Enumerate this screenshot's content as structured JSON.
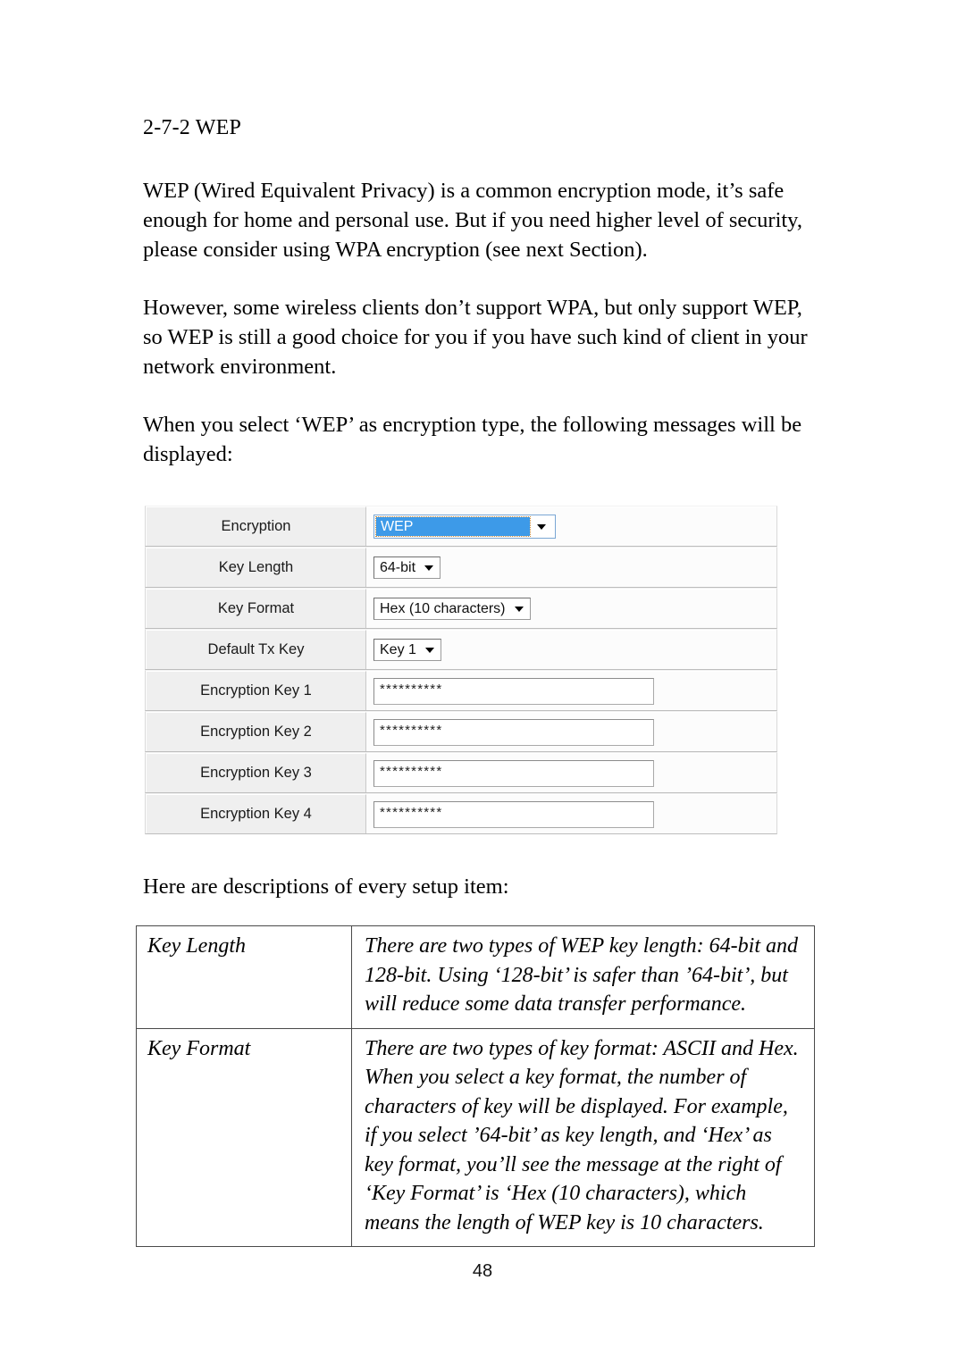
{
  "document": {
    "section_heading": "2-7-2 WEP",
    "page_number": "48",
    "paragraphs": {
      "intro": "WEP (Wired Equivalent Privacy) is a common encryption mode, it’s safe enough for home and personal use. But if you need higher level of security, please consider using WPA encryption (see next Section).",
      "clients": "However, some wireless clients don’t support WPA, but only support WEP, so WEP is still a good choice for you if you have such kind of client in your network environment.",
      "select_wep": "When you select ‘WEP’ as encryption type, the following messages will be displayed:",
      "descriptions_lead": "Here are descriptions of every setup item:"
    }
  },
  "form_screenshot": {
    "rows": [
      {
        "label": "Encryption",
        "control": "select-focused",
        "value": "WEP"
      },
      {
        "label": "Key Length",
        "control": "select",
        "value": "64-bit"
      },
      {
        "label": "Key Format",
        "control": "select",
        "value": "Hex (10 characters)"
      },
      {
        "label": "Default Tx Key",
        "control": "select",
        "value": "Key 1"
      },
      {
        "label": "Encryption Key 1",
        "control": "password",
        "value": "**********"
      },
      {
        "label": "Encryption Key 2",
        "control": "password",
        "value": "**********"
      },
      {
        "label": "Encryption Key 3",
        "control": "password",
        "value": "**********"
      },
      {
        "label": "Encryption Key 4",
        "control": "password",
        "value": "**********"
      }
    ],
    "colors": {
      "selection_highlight": "#3d9ae8",
      "label_cell_background": "#efefef",
      "selection_text": "#ffffff"
    },
    "icons": {
      "dropdown": "chevron-down-icon"
    }
  },
  "descriptions_table": {
    "rows": [
      {
        "term": "Key Length",
        "definition": "There are two types of WEP key length: 64-bit and 128-bit. Using ‘128-bit’ is safer than ’64-bit’, but will reduce some data transfer performance."
      },
      {
        "term": "Key Format",
        "definition": "There are two types of key format: ASCII and Hex. When you select a key format, the number of characters of key will be displayed. For example, if you select ’64-bit’ as key length, and ‘Hex’ as key format, you’ll see the message at the right of ‘Key Format’ is ‘Hex (10 characters), which means the length of WEP key is 10 characters."
      }
    ]
  }
}
